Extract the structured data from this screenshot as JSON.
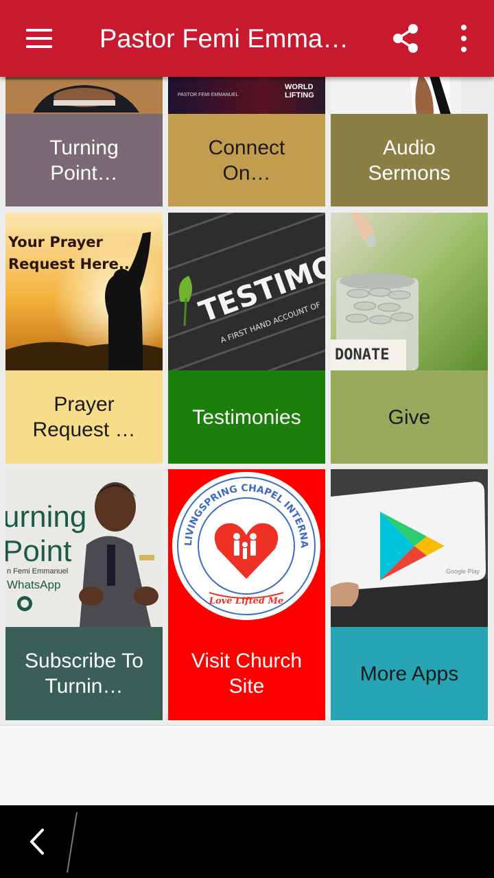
{
  "app_bar": {
    "title": "Pastor Femi Emmanuel",
    "menu_icon": "hamburger-menu-icon",
    "share_icon": "share-icon",
    "overflow_icon": "more-vert-icon",
    "color": "#c8192e"
  },
  "tiles_row1": [
    {
      "label": "Turning Point…",
      "color": "#7b6a74",
      "text_color": "#ffffff"
    },
    {
      "label": "Connect On…",
      "color": "#c29d4e",
      "text_color": "#1a1a1a"
    },
    {
      "label": "Audio Sermons",
      "color": "#8b7f45",
      "text_color": "#ffffff"
    }
  ],
  "tiles_row2": [
    {
      "label": "Prayer Request …",
      "color": "#f7dc8a",
      "text_color": "#1a1a1a",
      "image_text_lines": [
        "Your Prayer",
        "Request Here..."
      ]
    },
    {
      "label": "Testimonies",
      "color": "#1c7f0b",
      "text_color": "#ffffff",
      "image_text": "TESTIMONY",
      "image_subtext": "A FIRST HAND ACCOUNT OF"
    },
    {
      "label": "Give",
      "color": "#98ab5c",
      "text_color": "#1a1a1a",
      "image_text": "DONATE"
    }
  ],
  "tiles_row3": [
    {
      "label": "Subscribe To Turnin…",
      "color": "#3a5f56",
      "text_color": "#ffffff",
      "image_text_lines": [
        "urning",
        "Point",
        "n Femi Emmanuel",
        "WhatsApp"
      ]
    },
    {
      "label": "Visit Church Site",
      "color": "#ff0000",
      "text_color": "#ffffff",
      "image_text": "LIVINGSPRING CHAPEL INTERNATIONAL",
      "image_subtext": "Love Lifted Me"
    },
    {
      "label": "More Apps",
      "color": "#28a5b5",
      "text_color": "#1a1a1a",
      "image_text": "Google Play"
    }
  ],
  "top_strip": {
    "middle_lines": [
      "PASTOR FEMI EMMANUEL",
      "WORLD",
      "LIFTING"
    ]
  },
  "nav_bar": {
    "back_icon": "back-chevron-icon"
  }
}
